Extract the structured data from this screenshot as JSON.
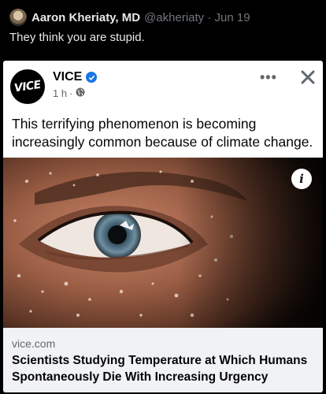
{
  "tweet": {
    "author_name": "Aaron Kheriaty, MD",
    "handle": "@akheriaty",
    "separator": "·",
    "date": "Jun 19",
    "text": "They think you are stupid."
  },
  "embedded_post": {
    "page_name": "VICE",
    "logo_text": "VICE",
    "verified": true,
    "time": "1 h",
    "meta_separator": "·",
    "audience_icon": "globe-icon",
    "more_icon": "more-options-icon",
    "close_icon": "close-icon",
    "text": "This terrifying phenomenon is becoming increasingly common because of climate change.",
    "image_description_icon": "info-icon",
    "info_label": "i",
    "link": {
      "domain": "vice.com",
      "title": "Scientists Studying Temperature at Which Humans Spontaneously Die With Increasing Urgency"
    }
  },
  "colors": {
    "background": "#000000",
    "tweet_text": "#e7e9ea",
    "handle": "#71767b",
    "card_bg": "#ffffff",
    "link_box_bg": "#f0f2f5",
    "verified_blue": "#1b74e4"
  }
}
